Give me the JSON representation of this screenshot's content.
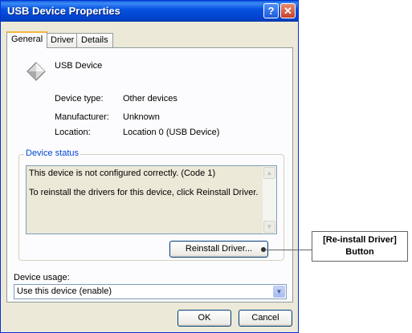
{
  "window": {
    "title": "USB Device Properties",
    "help_label": "?",
    "close_label": "✕"
  },
  "tabs": [
    {
      "label": "General",
      "active": true
    },
    {
      "label": "Driver",
      "active": false
    },
    {
      "label": "Details",
      "active": false
    }
  ],
  "device": {
    "name": "USB Device",
    "icon": "usb-device-icon"
  },
  "properties": [
    {
      "label": "Device type:",
      "value": "Other devices"
    },
    {
      "label": "Manufacturer:",
      "value": "Unknown"
    },
    {
      "label": "Location:",
      "value": "Location 0 (USB Device)"
    }
  ],
  "device_status": {
    "title": "Device status",
    "line1": "This device is not configured correctly. (Code 1)",
    "line2": "To reinstall the drivers for this device, click Reinstall Driver.",
    "reinstall_button": "Reinstall Driver..."
  },
  "device_usage": {
    "label": "Device usage:",
    "selected": "Use this device (enable)"
  },
  "buttons": {
    "ok": "OK",
    "cancel": "Cancel"
  },
  "callout": {
    "line1": "[Re-install Driver]",
    "line2": "Button"
  },
  "colors": {
    "titlebar": "#0553e0",
    "dialog_bg": "#ece9d8",
    "groupbox_title": "#0046d5"
  }
}
